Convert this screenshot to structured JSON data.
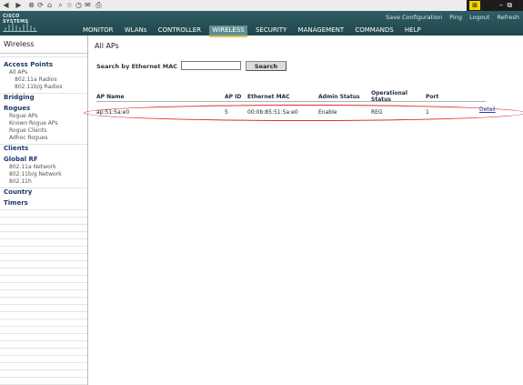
{
  "browser": {
    "toolbar_icons": [
      "back-icon",
      "forward-icon",
      "stop-icon",
      "refresh-icon",
      "home-icon",
      "search-icon",
      "favorites-icon",
      "history-icon",
      "mail-icon",
      "print-icon"
    ],
    "window_controls": "– ⧉ ✕"
  },
  "header": {
    "logo_text": "CISCO SYSTEMS",
    "utility_links": [
      "Save Configuration",
      "Ping",
      "Logout",
      "Refresh"
    ],
    "nav": [
      "MONITOR",
      "WLANs",
      "CONTROLLER",
      "WIRELESS",
      "SECURITY",
      "MANAGEMENT",
      "COMMANDS",
      "HELP"
    ],
    "active_nav": "WIRELESS",
    "accent": "#2f5d63"
  },
  "sidebar": {
    "title": "Wireless",
    "sections": [
      {
        "label": "Access Points",
        "items": [
          {
            "label": "All APs",
            "indent": 1
          },
          {
            "label": "802.11a Radios",
            "indent": 2
          },
          {
            "label": "802.11b/g Radios",
            "indent": 2
          }
        ]
      },
      {
        "label": "Bridging",
        "items": []
      },
      {
        "label": "Rogues",
        "items": [
          {
            "label": "Rogue APs",
            "indent": 1
          },
          {
            "label": "Known Rogue APs",
            "indent": 1
          },
          {
            "label": "Rogue Clients",
            "indent": 1
          },
          {
            "label": "Adhoc Rogues",
            "indent": 1
          }
        ]
      },
      {
        "label": "Clients",
        "items": []
      },
      {
        "label": "Global RF",
        "items": [
          {
            "label": "802.11a Network",
            "indent": 1
          },
          {
            "label": "802.11b/g Network",
            "indent": 1
          },
          {
            "label": "802.11h",
            "indent": 1
          }
        ]
      },
      {
        "label": "Country",
        "items": []
      },
      {
        "label": "Timers",
        "items": []
      }
    ]
  },
  "main": {
    "title": "All APs",
    "search": {
      "label": "Search by Ethernet MAC",
      "value": "",
      "button": "Search"
    },
    "table": {
      "columns": [
        "AP Name",
        "AP ID",
        "Ethernet MAC",
        "Admin Status",
        "Operational Status",
        "Port"
      ],
      "rows": [
        {
          "ap_name": "ap:51:5a:e0",
          "ap_id": "5",
          "mac": "00:0b:85:51:5a:e0",
          "admin": "Enable",
          "oper": "REG",
          "port": "1",
          "link": "Detail"
        }
      ]
    },
    "highlight_color": "#e03030"
  }
}
